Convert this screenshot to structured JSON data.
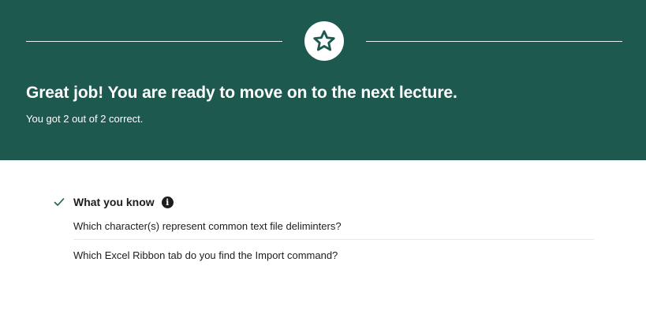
{
  "banner": {
    "icon": "star-icon",
    "headline": "Great job! You are ready to move on to the next lecture.",
    "score_text": "You got 2 out of 2 correct.",
    "colors": {
      "background": "#1e5950",
      "text": "#ffffff"
    }
  },
  "summary": {
    "check_icon": "checkmark-icon",
    "title": "What you know",
    "info_icon": "info-icon",
    "questions": [
      "Which character(s) represent common text file deliminters?",
      "Which Excel Ribbon tab do you find the Import command?"
    ],
    "colors": {
      "check": "#1e6055",
      "text": "#1c1d1f"
    }
  }
}
